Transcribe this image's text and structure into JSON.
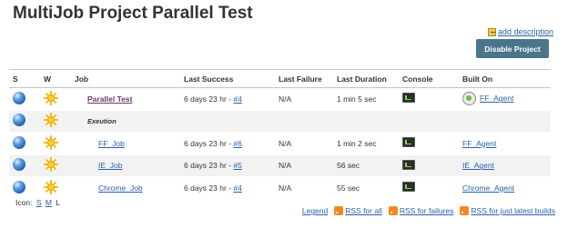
{
  "page": {
    "title": "MultiJob Project Parallel Test"
  },
  "actions": {
    "add_description": "add description",
    "disable_project": "Disable Project"
  },
  "table": {
    "headers": [
      "S",
      "W",
      "Job",
      "Last Success",
      "Last Failure",
      "Last Duration",
      "Console",
      "Built On"
    ],
    "rows": [
      {
        "job": "Parallel Test",
        "success_text": "6 days 23 hr - ",
        "success_build": "#4",
        "failure": "N/A",
        "duration": "1 min 5 sec",
        "built_on": "FF_Agent"
      },
      {
        "phase": "Exeution"
      },
      {
        "job": "FF_Job",
        "success_text": "6 days 23 hr - ",
        "success_build": "#6",
        "failure": "N/A",
        "duration": "1 min 2 sec",
        "built_on": "FF_Agent"
      },
      {
        "job": "IE_Job",
        "success_text": "6 days 23 hr - ",
        "success_build": "#5",
        "failure": "N/A",
        "duration": "56 sec",
        "built_on": "IE_Agent"
      },
      {
        "job": "Chrome_Job",
        "success_text": "6 days 23 hr - ",
        "success_build": "#4",
        "failure": "N/A",
        "duration": "55 sec",
        "built_on": "Chrome_Agent"
      }
    ]
  },
  "footer": {
    "icon_label": "Icon:",
    "size_s": "S",
    "size_m": "M",
    "size_l": "L",
    "legend": "Legend",
    "rss_all": "RSS for all",
    "rss_failures": "RSS for failures",
    "rss_latest": "RSS for just latest builds"
  },
  "colors": {
    "button_bg": "#4b758b",
    "link": "#2962a8",
    "row_alt": "#f2f2f2",
    "rss": "#f48a1f"
  },
  "icons": {
    "status": "blue-ball-icon",
    "weather": "sunny-icon",
    "console": "terminal-icon",
    "agent": "computer-agent-icon",
    "rss": "rss-icon",
    "edit": "pencil-icon"
  }
}
